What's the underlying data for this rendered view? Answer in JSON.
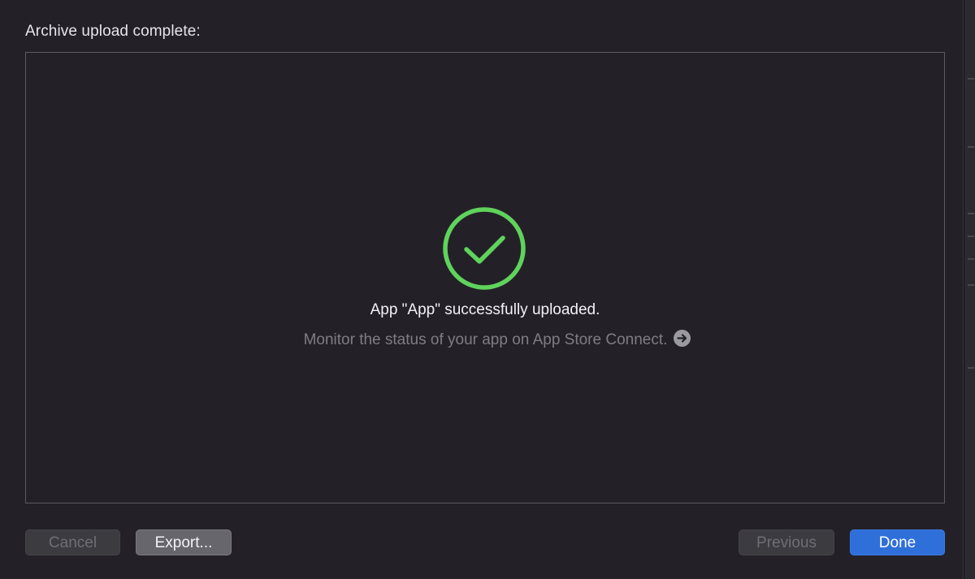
{
  "dialog": {
    "title": "Archive upload complete:",
    "success_message": "App \"App\" successfully uploaded.",
    "monitor_message": "Monitor the status of your app on App Store Connect.",
    "status_icon": "checkmark-circle-icon",
    "link_icon": "arrow-right-circle-icon"
  },
  "buttons": {
    "cancel": "Cancel",
    "export": "Export...",
    "previous": "Previous",
    "done": "Done"
  },
  "colors": {
    "success": "#5fd35c",
    "primary_button": "#2f6fd9"
  }
}
